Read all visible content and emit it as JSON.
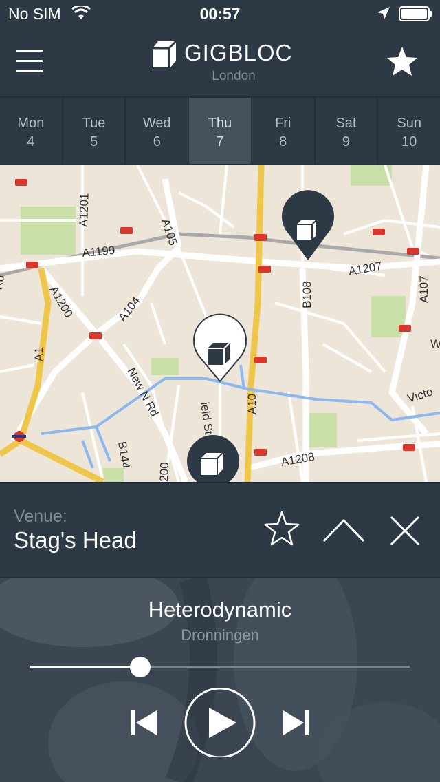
{
  "status_bar": {
    "carrier": "No SIM",
    "time": "00:57",
    "icons": [
      "wifi-icon",
      "location-arrow-icon",
      "battery-icon"
    ]
  },
  "header": {
    "brand": "GIGBLOC",
    "city": "London",
    "menu_icon": "hamburger-menu-icon",
    "favorite_icon": "star-filled-icon"
  },
  "days": [
    {
      "name": "Mon",
      "date": "4",
      "active": false
    },
    {
      "name": "Tue",
      "date": "5",
      "active": false
    },
    {
      "name": "Wed",
      "date": "6",
      "active": false
    },
    {
      "name": "Thu",
      "date": "7",
      "active": true
    },
    {
      "name": "Fri",
      "date": "8",
      "active": false
    },
    {
      "name": "Sat",
      "date": "9",
      "active": false
    },
    {
      "name": "Sun",
      "date": "10",
      "active": false
    }
  ],
  "map": {
    "road_labels": [
      "A1201",
      "A105",
      "A1199",
      "A10",
      "B108",
      "A1207",
      "A1200",
      "A104",
      "A1",
      "New N Rd",
      "B144",
      "A1208",
      "A107",
      "Victo",
      "Rd",
      "ield St",
      "200",
      "W"
    ],
    "markers": [
      "venue-marker",
      "venue-marker-selected",
      "venue-marker"
    ]
  },
  "venue": {
    "label": "Venue:",
    "name": "Stag's Head",
    "icons": [
      "star-outline-icon",
      "chevron-up-icon",
      "close-icon"
    ]
  },
  "player": {
    "track": "Heterodynamic",
    "artist": "Dronningen",
    "progress": 0.29,
    "icons": [
      "skip-back-icon",
      "play-icon",
      "skip-forward-icon"
    ]
  },
  "colors": {
    "header_bg": "#2d3945",
    "active_day_bg": "#45525e",
    "map_land": "#ede5d8",
    "major_road": "#f0c64a",
    "water": "#8cb8f0",
    "park": "#c8dfa8",
    "marker": "#2d3945"
  }
}
